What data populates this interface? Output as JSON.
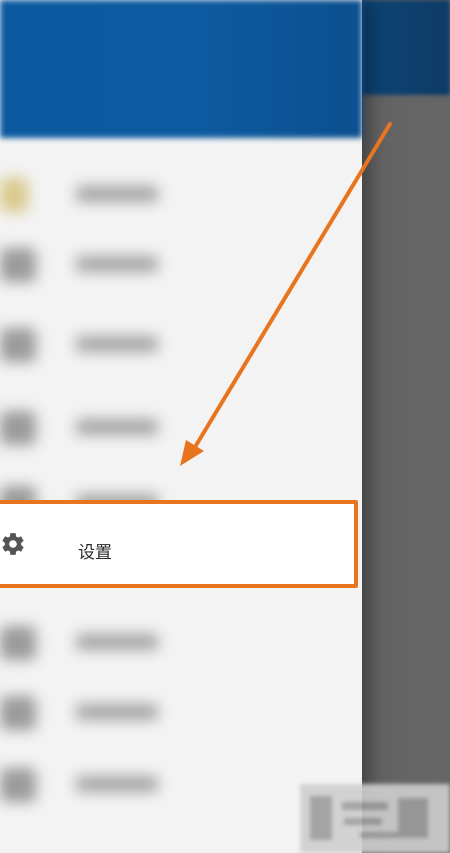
{
  "drawer": {
    "settings_label": "设置",
    "settings_icon": "gear-icon"
  },
  "annotation": {
    "color": "#e8741f"
  },
  "colors": {
    "header_blue": "#0c5aa0",
    "highlight_orange": "#e8741f"
  }
}
